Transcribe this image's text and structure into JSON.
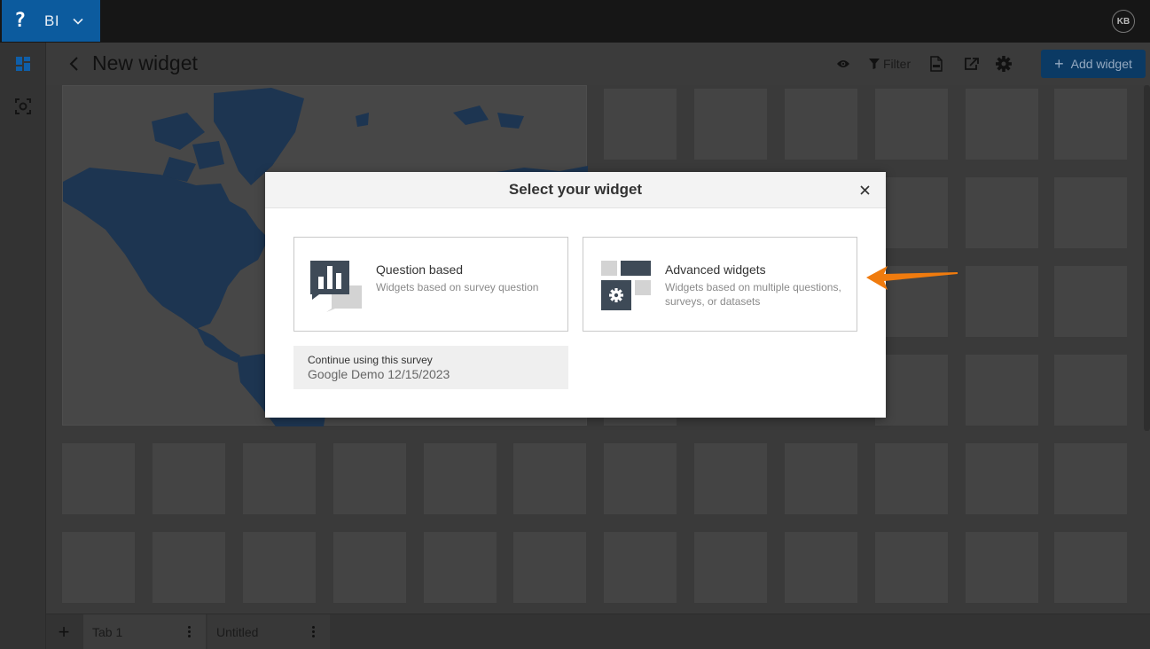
{
  "app": {
    "logo_glyph": "?",
    "name": "BI",
    "user_initials": "KB",
    "accent_color": "#0c5b9e"
  },
  "header": {
    "title": "New widget",
    "filter_label": "Filter",
    "add_widget_label": "Add widget",
    "icons": [
      "back-icon",
      "preview-eye-icon",
      "filter-icon",
      "pdf-icon",
      "share-icon",
      "settings-gear-icon"
    ]
  },
  "sidebar": {
    "items": [
      {
        "icon": "dashboard-icon"
      },
      {
        "icon": "scan-icon"
      }
    ]
  },
  "tabs": [
    {
      "label": "Tab 1"
    },
    {
      "label": "Untitled"
    }
  ],
  "modal": {
    "title": "Select your widget",
    "options": [
      {
        "title": "Question based",
        "description": "Widgets based on survey question",
        "icon": "bar-chart-icon"
      },
      {
        "title": "Advanced widgets",
        "description": "Widgets based on multiple questions, surveys, or datasets",
        "icon": "advanced-widgets-gear-icon"
      }
    ],
    "continue": {
      "label": "Continue using this survey",
      "survey_name": "Google Demo 12/15/2023"
    }
  },
  "annotation": {
    "arrow_color": "#f07b0e"
  }
}
